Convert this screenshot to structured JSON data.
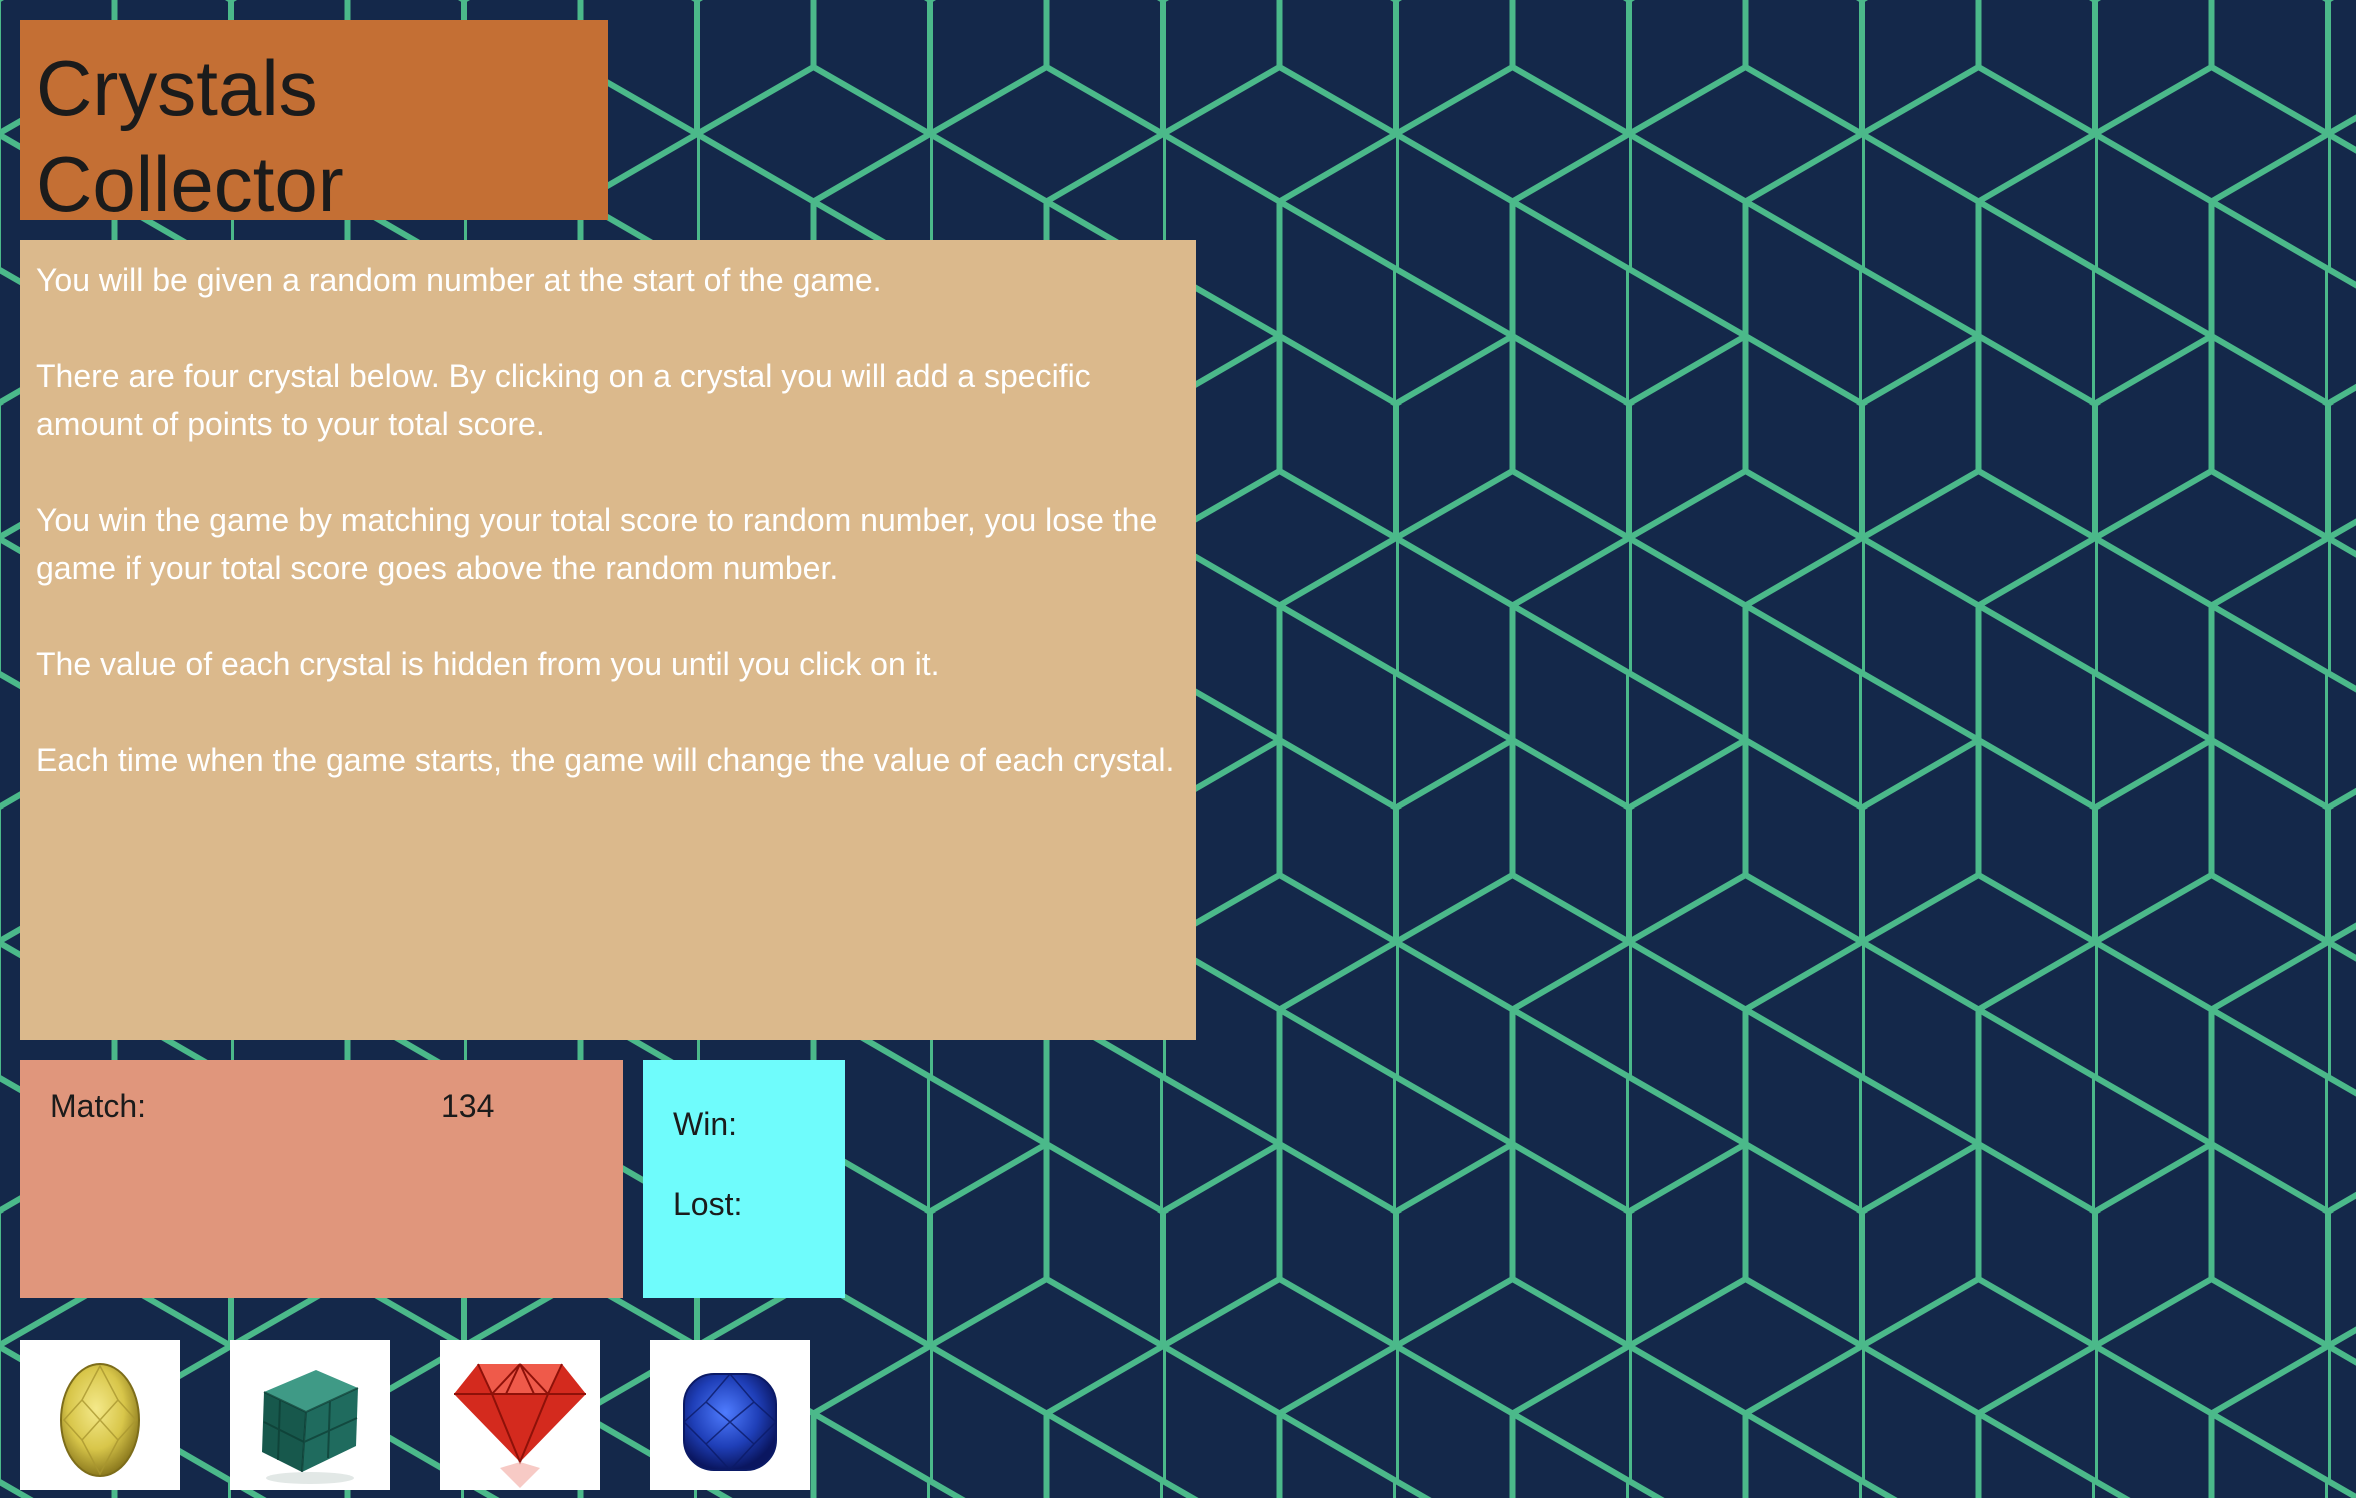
{
  "title": "Crystals Collector",
  "colors": {
    "background": "#14284a",
    "pattern_lines": "#4bb98a",
    "title_box": "#c46f34",
    "instructions_box": "#dbb98c",
    "match_box": "#e0967c",
    "score_box": "#6ffcfc"
  },
  "instructions": [
    "You will be given a random number at the start of the game.",
    "There are four crystal below. By clicking on a crystal you will add a specific amount of points to your total score.",
    "You win the game by matching your total score to random number, you lose the game if your total score goes above the random number.",
    "The value of each crystal is hidden from you until you click on it.",
    "Each time when the game starts, the game will change the value of each crystal."
  ],
  "match": {
    "label": "Match:",
    "value": "134"
  },
  "score": {
    "win_label": "Win:",
    "lost_label": "Lost:"
  },
  "crystals": [
    {
      "name": "yellow-oval-gem",
      "color": "#d8c64a"
    },
    {
      "name": "green-cube-gem",
      "color": "#1f6b5e"
    },
    {
      "name": "red-diamond-gem",
      "color": "#d42a1e"
    },
    {
      "name": "blue-cushion-gem",
      "color": "#1f3fb8"
    }
  ]
}
